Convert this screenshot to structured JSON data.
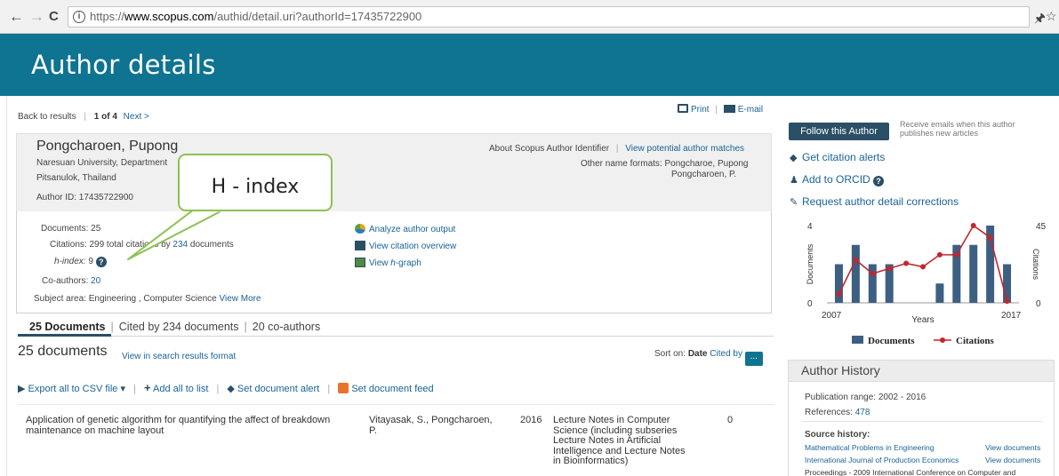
{
  "browser": {
    "url_prefix": "https://",
    "url_domain": "www.scopus.com",
    "url_path": "/authid/detail.uri?authorId=17435722900",
    "back_glyph": "←",
    "forward_glyph": "→",
    "reload_glyph": "C",
    "info_glyph": "i",
    "pin_glyph": "🖈",
    "star_glyph": "☆"
  },
  "header": {
    "title": "Author details"
  },
  "top_nav": {
    "back": "Back to results",
    "sep": "|",
    "position": "1 of 4",
    "next": "Next >",
    "print": "Print",
    "email": "E-mail"
  },
  "profile": {
    "name": "Pongcharoen, Pupong",
    "affiliation": "Naresuan University, Department",
    "location": "Pitsanulok, Thailand",
    "author_id": "Author ID: 17435722900",
    "about_link": "About Scopus Author Identifier",
    "matches_link": "View potential author matches",
    "other_formats_label": "Other name formats: Pongcharoe, Pupong",
    "other_formats_2": "Pongcharoen, P."
  },
  "callout": {
    "text": "H - index"
  },
  "metrics": {
    "documents_label": "Documents:",
    "documents_value": "25",
    "citations_label": "Citations:",
    "citations_pre": "299 total citations by",
    "citations_docs": "234",
    "citations_post": "documents",
    "hindex_label": "h-index:",
    "hindex_value": "9",
    "coauthors_label": "Co-authors:",
    "coauthors_value": "20",
    "subject_label": "Subject area:",
    "subject_value": "Engineering , Computer Science",
    "view_more": "View More",
    "analyze": "Analyze author output",
    "citation_overview": "View citation overview",
    "hgraph_pre": "View",
    "hgraph_h": "h",
    "hgraph_post": "-graph"
  },
  "tabs": {
    "documents": "25 Documents",
    "cited": "Cited by 234 documents",
    "coauthors": "20 co-authors",
    "sep": "|"
  },
  "doc_list": {
    "count": "25 documents",
    "view_format": "View in search results format",
    "sort_label": "Sort on:",
    "sort_date": "Date",
    "sort_cited": "Cited by",
    "more_btn": "...",
    "export": "Export all to CSV file",
    "add_all": "Add all to list",
    "doc_alert": "Set document alert",
    "doc_feed": "Set document feed"
  },
  "first_row": {
    "title_1": "Application of genetic algorithm for quantifying the affect of breakdown",
    "title_2": "maintenance on machine layout",
    "authors_1": "Vitayasak, S., Pongcharoen,",
    "authors_2": "P.",
    "year": "2016",
    "source_1": "Lecture Notes in Computer",
    "source_2": "Science (including subseries",
    "source_3": "Lecture Notes in Artificial",
    "source_4": "Intelligence and Lecture Notes",
    "source_5": "in Bioinformatics)",
    "cited": "0"
  },
  "right_panel": {
    "follow": "Follow this Author",
    "follow_desc_1": "Receive emails when this author",
    "follow_desc_2": "publishes new articles",
    "citation_alerts": "Get citation alerts",
    "add_orcid": "Add to ORCID",
    "request_corrections": "Request author detail corrections"
  },
  "chart_data": {
    "type": "bar+line",
    "x": [
      2007,
      2008,
      2009,
      2010,
      2011,
      2012,
      2013,
      2014,
      2015,
      2016,
      2017
    ],
    "series": [
      {
        "name": "Documents",
        "kind": "bar",
        "axis": "left",
        "color": "#3d5f82",
        "values": [
          2,
          3,
          2,
          2,
          0,
          0,
          1,
          3,
          3,
          4,
          2
        ]
      },
      {
        "name": "Citations",
        "kind": "line",
        "axis": "right",
        "color": "#c0272d",
        "values": [
          5,
          25,
          17,
          20,
          23,
          21,
          28,
          28,
          45,
          38,
          1
        ]
      }
    ],
    "left_ticks": [
      "4",
      "0"
    ],
    "right_ticks": [
      "45",
      "0"
    ],
    "x_ticks": [
      "2007",
      "2017"
    ],
    "ylim_left": [
      0,
      4
    ],
    "ylim_right": [
      0,
      45
    ],
    "xlabel": "Years",
    "ylabel_left": "Documents",
    "ylabel_right": "Citations",
    "legend_position": "bottom"
  },
  "history": {
    "title": "Author History",
    "range": "Publication range: 2002 - 2016",
    "references_label": "References:",
    "references_value": "478",
    "source_label": "Source history:",
    "sources": [
      {
        "name": "Mathematical Problems in Engineering",
        "action": "View documents"
      },
      {
        "name": "International Journal of Production Economics",
        "action": "View documents"
      }
    ],
    "truncated_source": "Proceedings - 2009 International Conference on Computer and"
  }
}
